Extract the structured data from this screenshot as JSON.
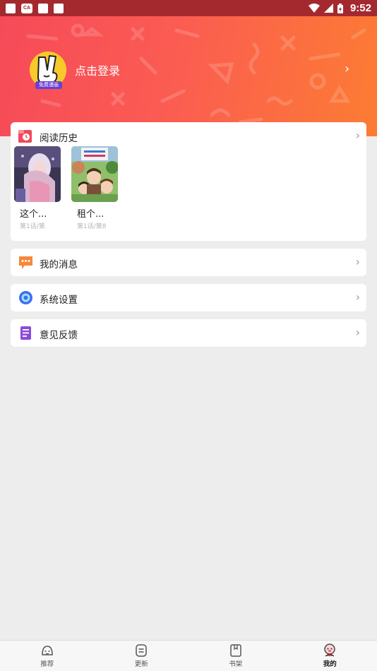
{
  "status_bar": {
    "time": "9:52",
    "badge_text": "CA",
    "notification_icons": [
      "square-icon",
      "ca-badge-icon",
      "square-icon",
      "a-badge-icon"
    ],
    "system_icons": [
      "wifi-icon",
      "signal-icon",
      "battery-icon"
    ]
  },
  "header": {
    "login_label": "点击登录",
    "avatar_badge": "免费漫画",
    "gradient": [
      "#f64a59",
      "#fc7c33"
    ]
  },
  "history": {
    "title": "阅读历史",
    "books": [
      {
        "title": "这个...",
        "progress": "第1话/第"
      },
      {
        "title": "租个...",
        "progress": "第1话/第8"
      }
    ]
  },
  "menu": {
    "messages": "我的消息",
    "settings": "系统设置",
    "feedback": "意见反馈"
  },
  "bottom_nav": {
    "items": [
      {
        "label": "推荐",
        "icon": "recommend-icon"
      },
      {
        "label": "更新",
        "icon": "update-icon"
      },
      {
        "label": "书架",
        "icon": "bookshelf-icon"
      },
      {
        "label": "我的",
        "icon": "profile-icon",
        "active": true
      }
    ]
  },
  "colors": {
    "accent_red": "#f64a59",
    "accent_orange": "#fc7c33",
    "message_icon": "#f7883a",
    "settings_icon": "#3d6ef0",
    "feedback_icon": "#8a4bdb"
  }
}
